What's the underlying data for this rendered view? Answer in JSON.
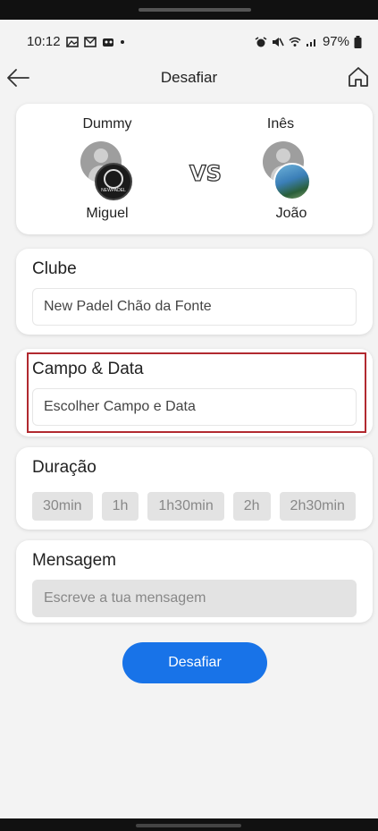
{
  "status": {
    "time": "10:12",
    "battery": "97%"
  },
  "header": {
    "title": "Desafiar"
  },
  "match": {
    "top_left": "Dummy",
    "top_right": "Inês",
    "bottom_left": "Miguel",
    "bottom_right": "João",
    "club_badge_text": "NEWPADEL"
  },
  "club": {
    "label": "Clube",
    "value": "New Padel Chão da Fonte"
  },
  "court_date": {
    "label": "Campo & Data",
    "placeholder": "Escolher Campo e Data"
  },
  "duration": {
    "label": "Duração",
    "options": [
      "30min",
      "1h",
      "1h30min",
      "2h",
      "2h30min"
    ]
  },
  "message": {
    "label": "Mensagem",
    "placeholder": "Escreve a tua mensagem"
  },
  "actions": {
    "submit": "Desafiar"
  },
  "colors": {
    "accent": "#1873e8",
    "highlight": "#b1292f"
  }
}
